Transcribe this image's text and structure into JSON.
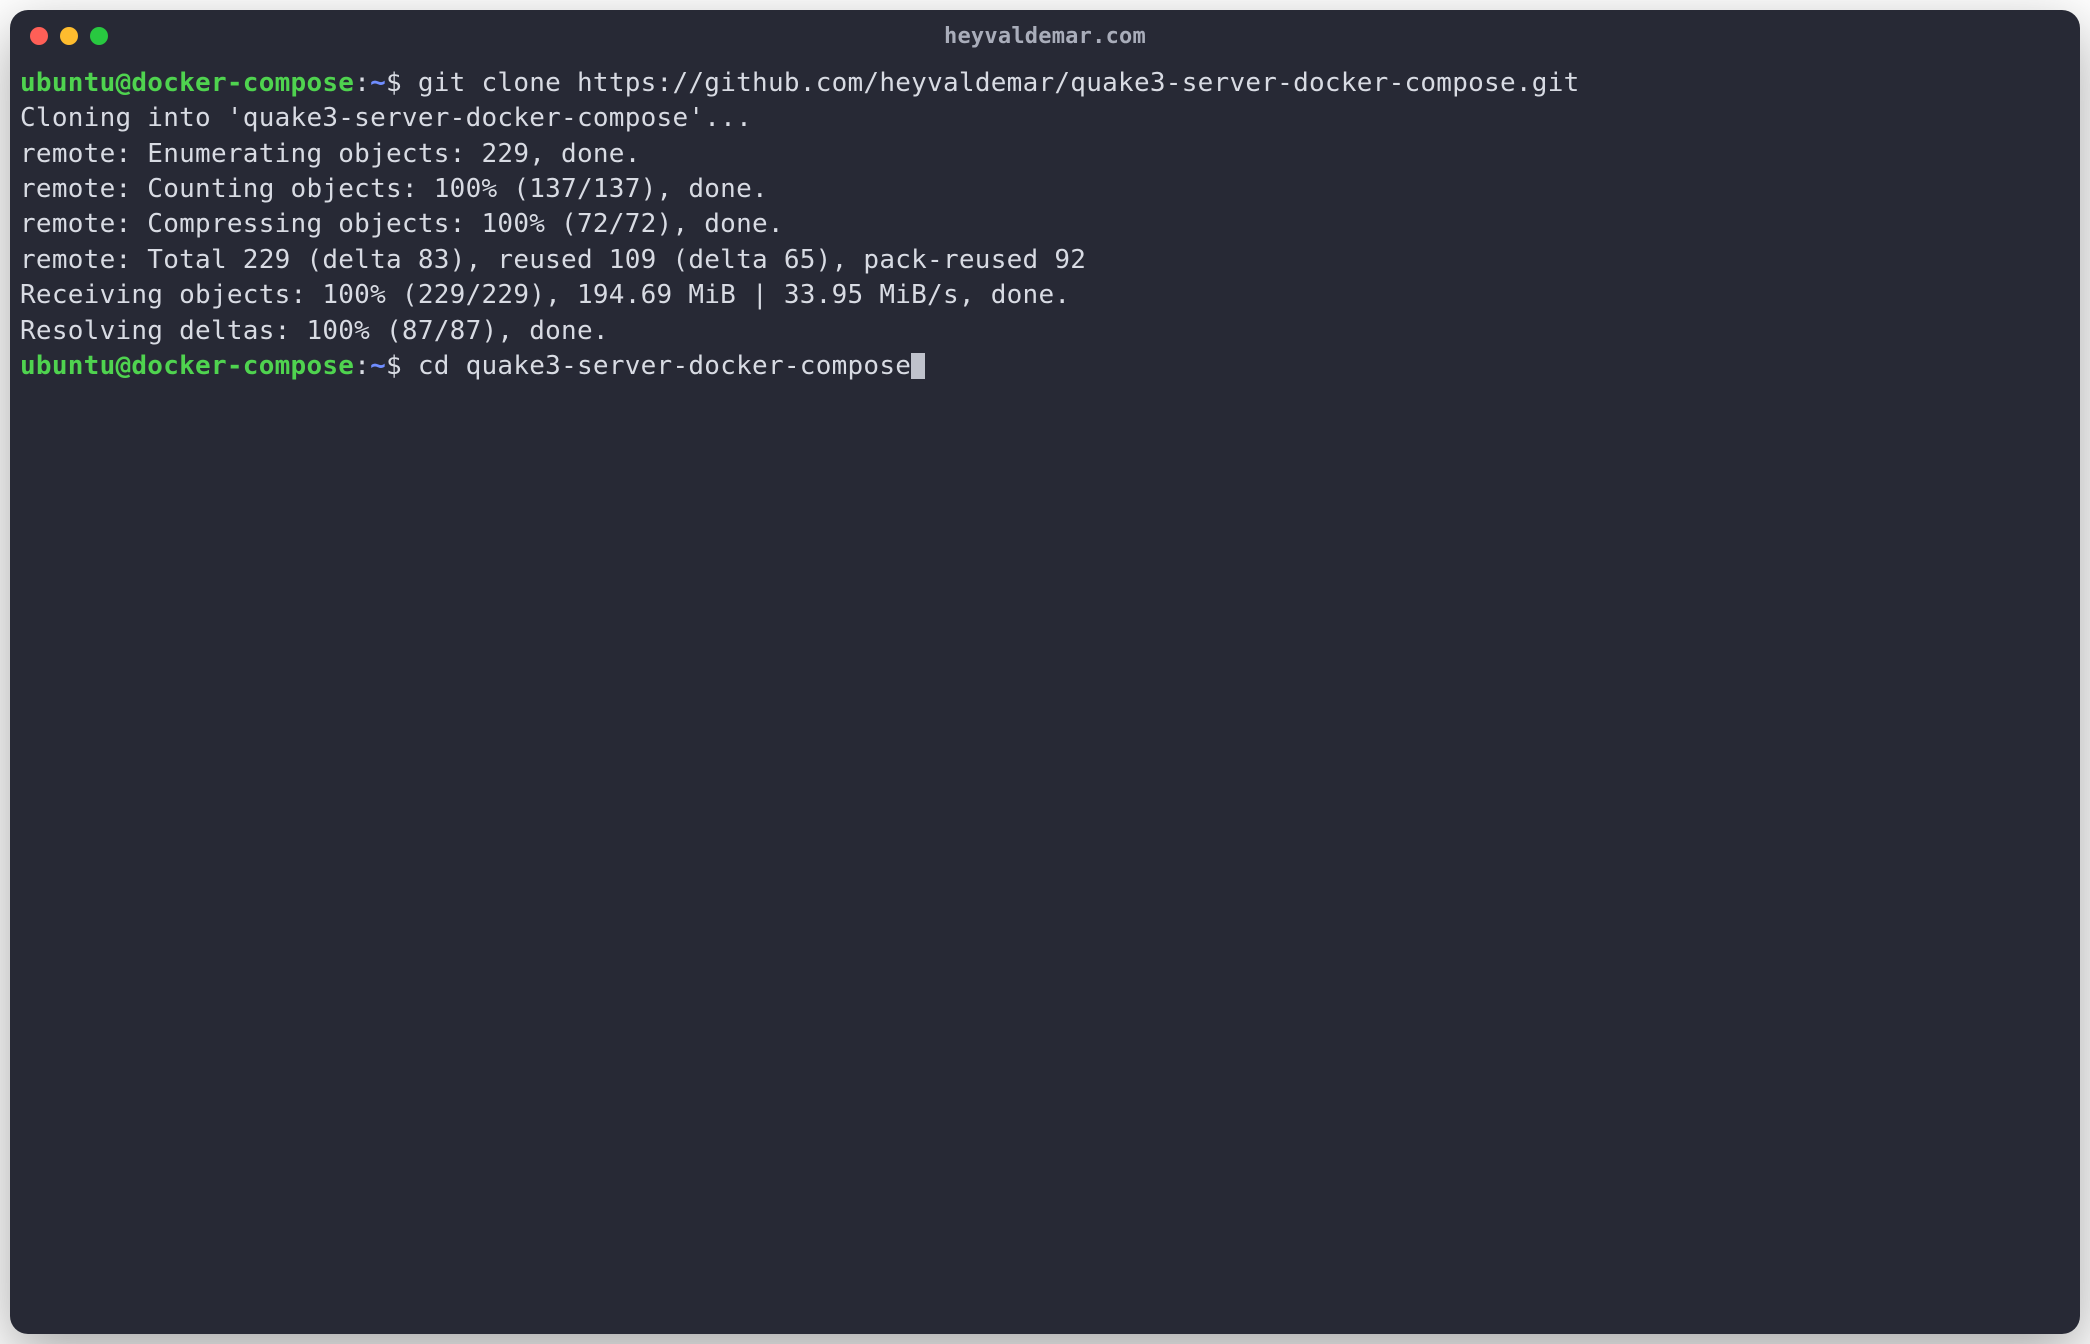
{
  "window": {
    "title": "heyvaldemar.com"
  },
  "prompt": {
    "user_host": "ubuntu@docker-compose",
    "colon": ":",
    "path": "~",
    "dollar": "$"
  },
  "lines": [
    {
      "type": "prompt",
      "command": "git clone https://github.com/heyvaldemar/quake3-server-docker-compose.git"
    },
    {
      "type": "output",
      "text": "Cloning into 'quake3-server-docker-compose'..."
    },
    {
      "type": "output",
      "text": "remote: Enumerating objects: 229, done."
    },
    {
      "type": "output",
      "text": "remote: Counting objects: 100% (137/137), done."
    },
    {
      "type": "output",
      "text": "remote: Compressing objects: 100% (72/72), done."
    },
    {
      "type": "output",
      "text": "remote: Total 229 (delta 83), reused 109 (delta 65), pack-reused 92"
    },
    {
      "type": "output",
      "text": "Receiving objects: 100% (229/229), 194.69 MiB | 33.95 MiB/s, done."
    },
    {
      "type": "output",
      "text": "Resolving deltas: 100% (87/87), done."
    },
    {
      "type": "prompt",
      "command": "cd quake3-server-docker-compose",
      "cursor": true
    }
  ]
}
